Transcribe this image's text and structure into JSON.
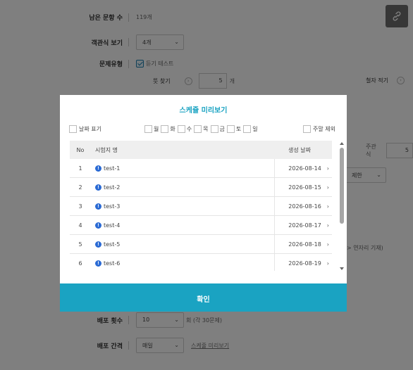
{
  "form": {
    "remaining_label": "남은 문항 수",
    "remaining_value": "119개",
    "choice_label": "객관식 보기",
    "choice_value": "4개",
    "type_label": "문제유형",
    "listening_label": "듣기 테스트",
    "meaning_label": "뜻 찾기",
    "meaning_count": "5",
    "meaning_unit": "개",
    "spelling_label": "철자 적기",
    "subjective_label": "주관식",
    "subjective_count": "5",
    "limit_select_fragment": "제한",
    "partial_hint": "> 연자리 기재)",
    "dist_count_label": "배포 횟수",
    "dist_count_value": "10",
    "dist_count_suffix": "회 (각 30문제)",
    "dist_interval_label": "배포 간격",
    "dist_interval_value": "매일",
    "schedule_preview_link": "스케쥴 미리보기"
  },
  "modal": {
    "title": "스케쥴 미리보기",
    "show_date_label": "날짜 표기",
    "days": [
      "월",
      "화",
      "수",
      "목",
      "금",
      "토",
      "일"
    ],
    "exclude_weekend_label": "주말 제외",
    "columns": {
      "no": "No",
      "name": "시험지 명",
      "date": "생성 날짜"
    },
    "rows": [
      {
        "no": "1",
        "name": "test-1",
        "date": "2026-08-14"
      },
      {
        "no": "2",
        "name": "test-2",
        "date": "2026-08-15"
      },
      {
        "no": "3",
        "name": "test-3",
        "date": "2026-08-16"
      },
      {
        "no": "4",
        "name": "test-4",
        "date": "2026-08-17"
      },
      {
        "no": "5",
        "name": "test-5",
        "date": "2026-08-18"
      },
      {
        "no": "6",
        "name": "test-6",
        "date": "2026-08-19"
      }
    ],
    "confirm_label": "확인"
  },
  "colors": {
    "accent": "#1aa3c2",
    "info": "#2a6ad4"
  },
  "icons": {
    "link": "link-icon",
    "info": "info-icon",
    "chevron": "chevron-right-icon"
  }
}
